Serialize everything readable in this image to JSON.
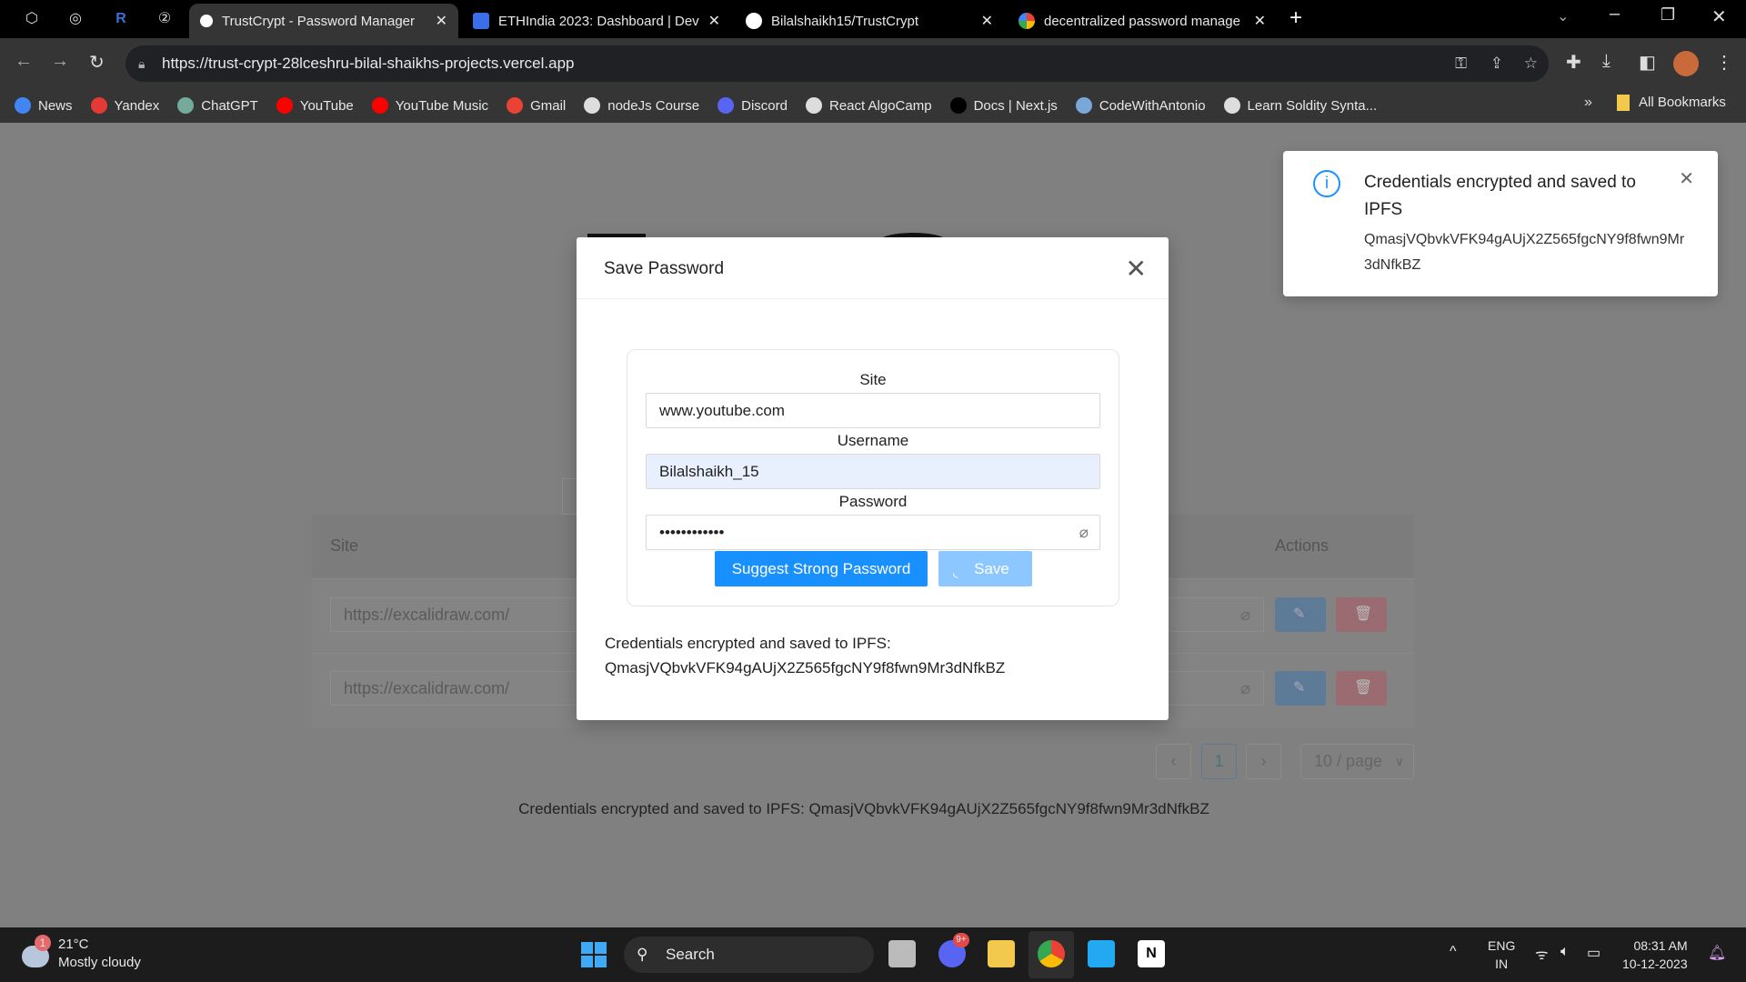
{
  "browser": {
    "tabs": [
      {
        "title": "TrustCrypt - Password Manager",
        "active": true
      },
      {
        "title": "ETHIndia 2023: Dashboard | Dev"
      },
      {
        "title": "Bilalshaikh15/TrustCrypt"
      },
      {
        "title": "decentralized password manage"
      }
    ],
    "url": "https://trust-crypt-28lceshru-bilal-shaikhs-projects.vercel.app",
    "bookmarks": [
      {
        "label": "News",
        "color": "#4285f4"
      },
      {
        "label": "Yandex",
        "color": "#e53935"
      },
      {
        "label": "ChatGPT",
        "color": "#74aa9c"
      },
      {
        "label": "YouTube",
        "color": "#ff0000"
      },
      {
        "label": "YouTube Music",
        "color": "#ff0000"
      },
      {
        "label": "Gmail",
        "color": "#ea4335"
      },
      {
        "label": "nodeJs Course",
        "color": "#ddd"
      },
      {
        "label": "Discord",
        "color": "#5865f2"
      },
      {
        "label": "React AlgoCamp",
        "color": "#ddd"
      },
      {
        "label": "Docs | Next.js",
        "color": "#000"
      },
      {
        "label": "CodeWithAntonio",
        "color": "#7aa7d9"
      },
      {
        "label": "Learn Soldity Synta...",
        "color": "#ddd"
      }
    ],
    "all_bookmarks": "All Bookmarks"
  },
  "table": {
    "headers": {
      "site": "Site",
      "actions": "Actions"
    },
    "rows": [
      {
        "site": "https://excalidraw.com/"
      },
      {
        "site": "https://excalidraw.com/"
      }
    ],
    "pagination": {
      "current": "1",
      "page_size": "10 / page"
    }
  },
  "footer_status": "Credentials encrypted and saved to IPFS: QmasjVQbvkVFK94gAUjX2Z565fgcNY9f8fwn9Mr3dNfkBZ",
  "modal": {
    "title": "Save Password",
    "site_label": "Site",
    "site_value": "www.youtube.com",
    "username_label": "Username",
    "username_value": "Bilalshaikh_15",
    "password_label": "Password",
    "password_value": "••••••••••••",
    "suggest_label": "Suggest Strong Password",
    "save_label": "Save",
    "result_line1": "Credentials encrypted and saved to IPFS:",
    "result_line2": "QmasjVQbvkVFK94gAUjX2Z565fgcNY9f8fwn9Mr3dNfkBZ"
  },
  "toast": {
    "title": "Credentials encrypted and saved to IPFS",
    "hash": "QmasjVQbvkVFK94gAUjX2Z565fgcNY9f8fwn9Mr3dNfkBZ"
  },
  "taskbar": {
    "temp": "21°C",
    "weather": "Mostly cloudy",
    "weather_badge": "1",
    "search": "Search",
    "lang1": "ENG",
    "lang2": "IN",
    "time": "08:31 AM",
    "date": "10-12-2023",
    "discord_badge": "9+"
  }
}
